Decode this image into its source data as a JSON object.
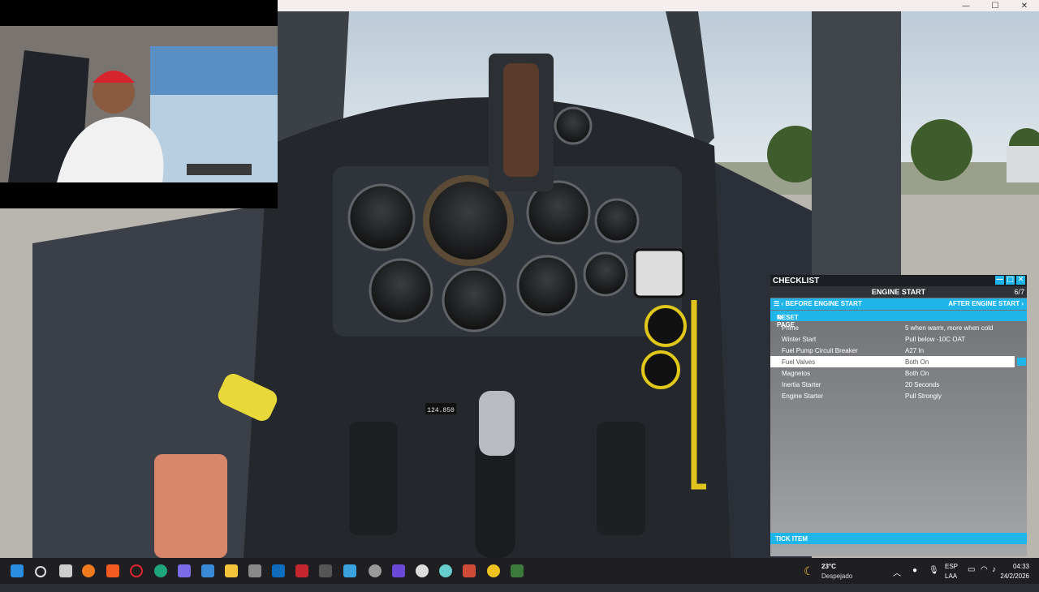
{
  "window": {
    "controls": [
      "—",
      "☐",
      "✕"
    ]
  },
  "checklist": {
    "title": "CHECKLIST",
    "window_buttons": [
      "—",
      "□",
      "✕"
    ],
    "section": "ENGINE START",
    "page": "6/7",
    "prev_label": "BEFORE ENGINE START",
    "next_label": "AFTER ENGINE START",
    "reset_label": "RESET PAGE",
    "items": [
      {
        "label": "Prime",
        "value": "5 when warm, more when cold"
      },
      {
        "label": "Winter Start",
        "value": "Pull below -10C OAT"
      },
      {
        "label": "Fuel Pump Circuit Breaker",
        "value": "A27 In"
      },
      {
        "label": "Fuel Valves",
        "value": "Both On"
      },
      {
        "label": "Magnetos",
        "value": "Both On"
      },
      {
        "label": "Inertia Starter",
        "value": "20 Seconds"
      },
      {
        "label": "Engine Starter",
        "value": "Pull Strongly"
      }
    ],
    "selected_index": 3,
    "tick_label": "TICK ITEM"
  },
  "cockpit": {
    "radio_frequency": "124.850"
  },
  "taskbar": {
    "weather_temp": "23°C",
    "weather_desc": "Despejado",
    "lang_top": "ESP",
    "lang_bottom": "LAA",
    "time": "04:33",
    "date": "24/2/2026"
  },
  "colors": {
    "accent": "#1fb5e8",
    "taskbar": "#1f1f22"
  }
}
